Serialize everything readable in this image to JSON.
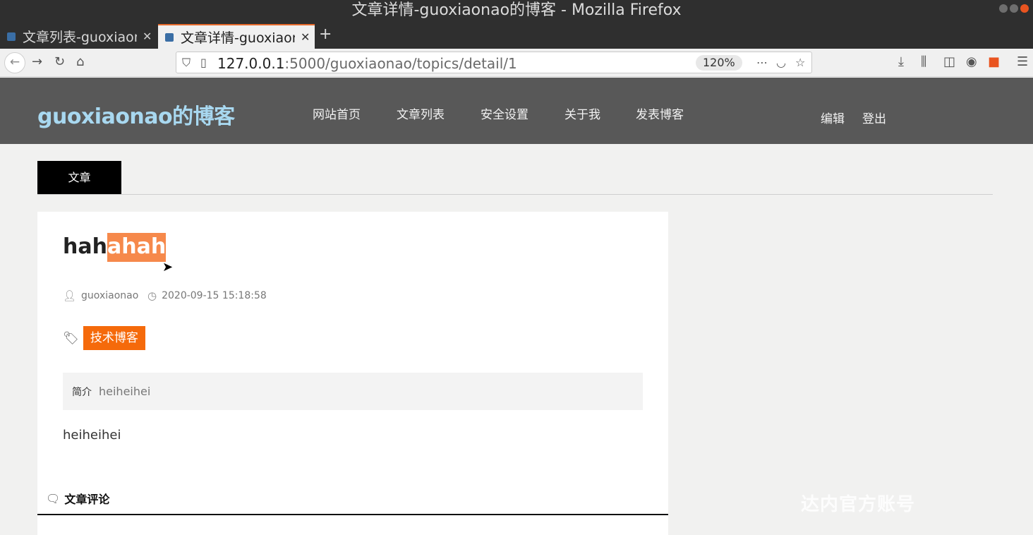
{
  "window": {
    "title": "文章详情-guoxiaonao的博客 - Mozilla Firefox"
  },
  "tabs": [
    {
      "label": "文章列表-guoxiaonao",
      "active": false
    },
    {
      "label": "文章详情-guoxiaonao",
      "active": true
    }
  ],
  "new_tab_label": "+",
  "urlbar": {
    "host": "127.0.0.1",
    "path": ":5000/guoxiaonao/topics/detail/1",
    "zoom": "120%"
  },
  "site": {
    "brand": "guoxiaonao的博客",
    "menu": [
      "网站首页",
      "文章列表",
      "安全设置",
      "关于我",
      "发表博客"
    ],
    "user_menu": [
      "编辑",
      "登出"
    ]
  },
  "section_tab": "文章",
  "article": {
    "title_plain": "hah",
    "title_selected": "ahah",
    "author": "guoxiaonao",
    "datetime": "2020-09-15 15:18:58",
    "tag": "技术博客",
    "summary_label": "简介",
    "summary": "heiheihei",
    "content": "heiheihei"
  },
  "comments": {
    "heading": "文章评论"
  },
  "watermark": "达内官方账号",
  "colors": {
    "header_bg": "#585858",
    "brand": "#a8d8f0",
    "tag_bg": "#f56a0b",
    "selection": "#f6894b",
    "tab_accent": "#e66a2c"
  },
  "icons": {
    "author": "user-icon",
    "time": "clock-icon",
    "tags": "tags-icon",
    "comments": "speech-bubble-icon"
  }
}
